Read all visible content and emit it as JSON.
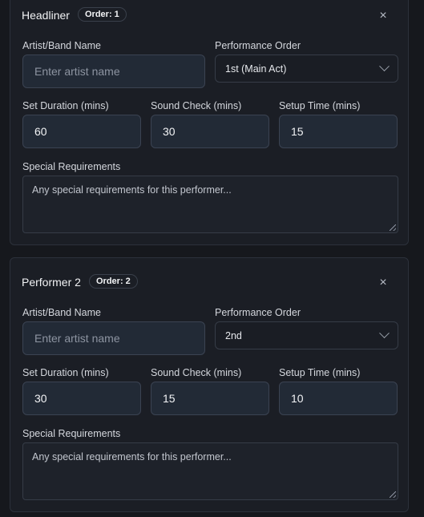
{
  "performers": [
    {
      "title": "Headliner",
      "order_badge": "Order: 1",
      "artist_label": "Artist/Band Name",
      "artist_placeholder": "Enter artist name",
      "order_label": "Performance Order",
      "order_value": "1st (Main Act)",
      "set_label": "Set Duration (mins)",
      "set_value": "60",
      "sound_label": "Sound Check (mins)",
      "sound_value": "30",
      "setup_label": "Setup Time (mins)",
      "setup_value": "15",
      "special_label": "Special Requirements",
      "special_placeholder": "Any special requirements for this performer..."
    },
    {
      "title": "Performer 2",
      "order_badge": "Order: 2",
      "artist_label": "Artist/Band Name",
      "artist_placeholder": "Enter artist name",
      "order_label": "Performance Order",
      "order_value": "2nd",
      "set_label": "Set Duration (mins)",
      "set_value": "30",
      "sound_label": "Sound Check (mins)",
      "sound_value": "15",
      "setup_label": "Setup Time (mins)",
      "setup_value": "10",
      "special_label": "Special Requirements",
      "special_placeholder": "Any special requirements for this performer..."
    }
  ],
  "close_glyph": "×"
}
